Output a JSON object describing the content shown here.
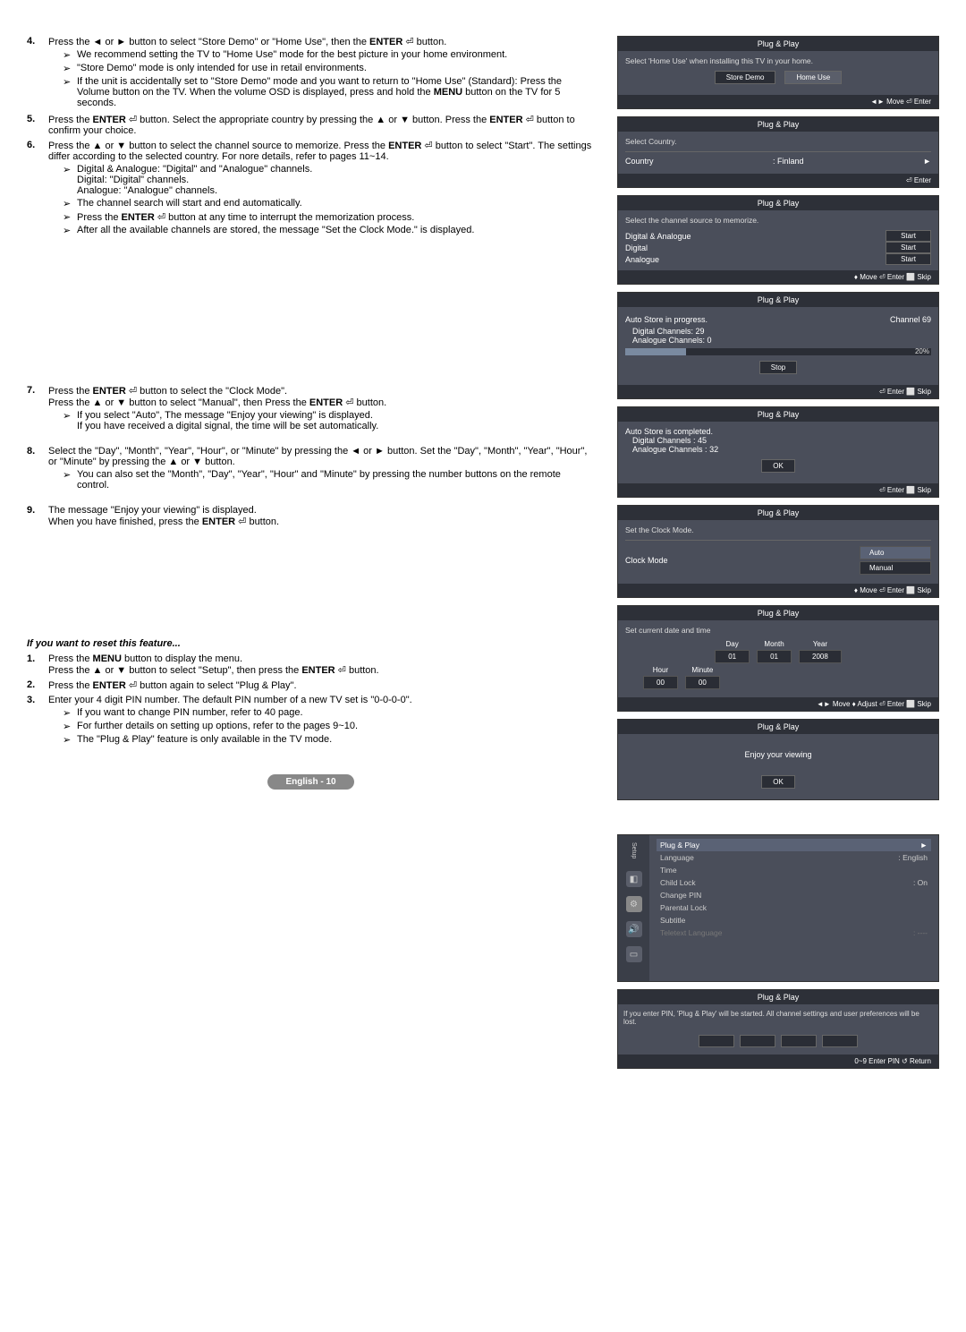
{
  "steps": {
    "s4": {
      "num": "4.",
      "text1": "Press the ◄ or ► button to select \"Store Demo\" or \"Home Use\", then the ",
      "bold1": "ENTER",
      "icon1": "⏎",
      "text2": " button.",
      "b1": "We recommend setting the TV to \"Home Use\" mode for the best picture in your home environment.",
      "b2": "\"Store Demo\" mode is only intended for use in retail environments.",
      "b3a": "If the unit is accidentally set to \"Store Demo\" mode and you want to return to \"Home Use\" (Standard): Press the Volume button on the TV. When the volume OSD is displayed, press and hold the ",
      "b3bold": "MENU",
      "b3b": " button on the TV for 5 seconds."
    },
    "s5": {
      "num": "5.",
      "t1": "Press the ",
      "bold1": "ENTER",
      "t2": " button. Select the appropriate country by pressing the ▲ or ▼ button. Press the ",
      "bold2": "ENTER",
      "t3": " button to confirm your choice."
    },
    "s6": {
      "num": "6.",
      "t1": "Press the ▲ or ▼ button to select the channel source to memorize. Press the ",
      "bold1": "ENTER",
      "t2": " button to select \"Start\". The settings differ according to the selected country. For nore details, refer to pages 11~14.",
      "b1": "Digital & Analogue: \"Digital\" and \"Analogue\" channels.\nDigital: \"Digital\" channels.\nAnalogue: \"Analogue\" channels.",
      "b2": "The channel search will start and end automatically.",
      "b3a": "Press the ",
      "b3bold": "ENTER",
      "b3b": " button at any time to interrupt the memorization process.",
      "b4": "After all the available channels are stored, the message \"Set the Clock Mode.\" is displayed."
    },
    "s7": {
      "num": "7.",
      "t1": "Press the ",
      "bold1": "ENTER",
      "t2": " button to select the \"Clock Mode\".\nPress the ▲ or ▼ button to select \"Manual\", then Press the ",
      "bold2": "ENTER",
      "t3": " button.",
      "b1": "If you select \"Auto\", The message \"Enjoy your viewing\" is displayed.\nIf you have received a digital signal, the time will be set automatically."
    },
    "s8": {
      "num": "8.",
      "t1": "Select the \"Day\", \"Month\", \"Year\", \"Hour\", or \"Minute\" by pressing the ◄ or ► button. Set the \"Day\", \"Month\", \"Year\", \"Hour\", or \"Minute\" by pressing the ▲ or ▼ button.",
      "b1": "You can also set the \"Month\", \"Day\", \"Year\", \"Hour\" and \"Minute\" by pressing the number buttons on the remote control."
    },
    "s9": {
      "num": "9.",
      "t1": "The message \"Enjoy your viewing\" is displayed.\nWhen you have finished, press the ",
      "bold1": "ENTER",
      "t2": " button."
    }
  },
  "reset": {
    "title": "If you want to reset this feature...",
    "s1num": "1.",
    "s1a": "Press the ",
    "s1bold": "MENU",
    "s1b": " button to display the menu.\nPress the ▲ or ▼ button to select \"Setup\", then press the ",
    "s1bold2": "ENTER",
    "s1c": " button.",
    "s2num": "2.",
    "s2a": "Press the ",
    "s2bold": "ENTER",
    "s2b": " button again to select \"Plug & Play\".",
    "s3num": "3.",
    "s3a": "Enter your 4 digit PIN number. The default PIN number of a new TV set is \"0-0-0-0\".",
    "s3b1": "If you want to change PIN number, refer to 40 page.",
    "s3b2": "For further details on setting up options, refer to the pages 9~10.",
    "s3b3": "The \"Plug & Play\" feature is only available in the TV mode."
  },
  "footer": "English - 10",
  "screens": {
    "title": "Plug & Play",
    "sc1": {
      "msg": "Select 'Home Use' when installing this TV in your home.",
      "b1": "Store Demo",
      "b2": "Home Use",
      "ft": "◄► Move    ⏎ Enter"
    },
    "sc2": {
      "msg": "Select Country.",
      "l": "Country",
      "v": "Finland",
      "ft": "⏎ Enter"
    },
    "sc3": {
      "msg": "Select the channel source to memorize.",
      "r1": "Digital & Analogue",
      "r2": "Digital",
      "r3": "Analogue",
      "btn": "Start",
      "ft": "♦ Move    ⏎ Enter    ⬜ Skip"
    },
    "sc4": {
      "l1": "Auto Store in progress.",
      "l2": "Digital Channels: 29",
      "l3": "Analogue Channels: 0",
      "ch": "Channel 69",
      "pct": "20%",
      "btn": "Stop",
      "ft": "⏎ Enter    ⬜ Skip"
    },
    "sc5": {
      "l1": "Auto Store is completed.",
      "l2": "Digital Channels : 45",
      "l3": "Analogue Channels : 32",
      "btn": "OK",
      "ft": "⏎ Enter    ⬜ Skip"
    },
    "sc6": {
      "msg": "Set the Clock Mode.",
      "l": "Clock Mode",
      "o1": "Auto",
      "o2": "Manual",
      "ft": "♦ Move    ⏎ Enter    ⬜ Skip"
    },
    "sc7": {
      "msg": "Set current  date and time",
      "day": "Day",
      "dayv": "01",
      "month": "Month",
      "monthv": "01",
      "year": "Year",
      "yearv": "2008",
      "hour": "Hour",
      "hourv": "00",
      "min": "Minute",
      "minv": "00",
      "ft": "◄► Move    ♦ Adjust    ⏎ Enter    ⬜ Skip"
    },
    "sc8": {
      "msg": "Enjoy your viewing",
      "btn": "OK"
    },
    "setup": {
      "side": "Setup",
      "r1": "Plug & Play",
      "r2": "Language",
      "r2v": ": English",
      "r3": "Time",
      "r4": "Child Lock",
      "r4v": ": On",
      "r5": "Change PIN",
      "r6": "Parental Lock",
      "r7": "Subtitle",
      "r8": "Teletext Language",
      "r8v": ": ----"
    },
    "pin": {
      "msg": "If you enter PIN, 'Plug & Play' will be started. All channel settings and user preferences will be lost.",
      "ft": "0~9 Enter PIN    ↺ Return"
    }
  }
}
